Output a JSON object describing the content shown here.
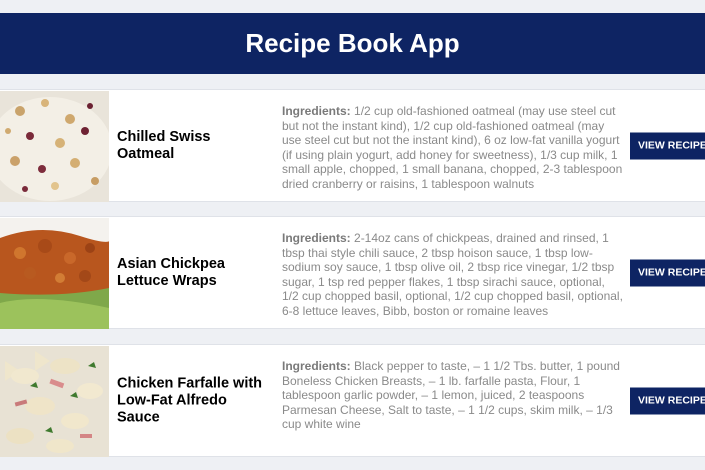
{
  "app": {
    "title": "Recipe Book App"
  },
  "recipes": [
    {
      "name": "Chilled Swiss Oatmeal",
      "ingredients_label": "Ingredients:",
      "ingredients": "1/2 cup old-fashioned oatmeal (may use steel cut but not the instant kind), 1/2 cup old-fashioned oatmeal (may use steel cut but not the instant kind), 6 oz low-fat vanilla yogurt (if using plain yogurt, add honey for sweetness), 1/3 cup milk, 1 small apple, chopped, 1 small banana, chopped, 2-3 tablespoon dried cranberry or raisins, 1 tablespoon walnuts",
      "button_label": "VIEW RECIPE"
    },
    {
      "name": "Asian Chickpea Lettuce Wraps",
      "ingredients_label": "Ingredients:",
      "ingredients": "2-14oz cans of chickpeas, drained and rinsed, 1 tbsp thai style chili sauce, 2 tbsp hoison sauce, 1 tbsp low-sodium soy sauce, 1 tbsp olive oil, 2 tbsp rice vinegar, 1/2 tbsp sugar, 1 tsp red pepper flakes, 1 tbsp sirachi sauce, optional, 1/2 cup chopped basil, optional, 1/2 cup chopped basil, optional, 6-8 lettuce leaves, Bibb, boston or romaine leaves",
      "button_label": "VIEW RECIPE"
    },
    {
      "name": "Chicken Farfalle with Low-Fat Alfredo Sauce",
      "ingredients_label": "Ingredients:",
      "ingredients": "Black pepper to taste, – 1 1/2 Tbs. butter, 1 pound Boneless Chicken Breasts, – 1 lb. farfalle pasta, Flour, 1 tablespoon garlic powder, – 1 lemon, juiced, 2 teaspoons Parmesan Cheese, Salt to taste, – 1 1/2 cups, skim milk, – 1/3 cup white wine",
      "button_label": "VIEW RECIPE"
    }
  ]
}
